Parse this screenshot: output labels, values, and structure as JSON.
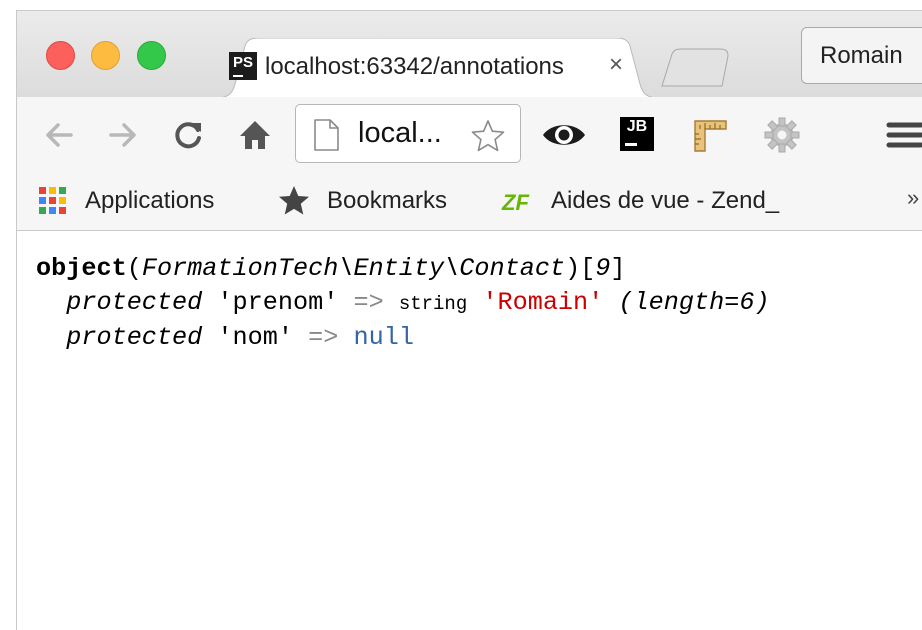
{
  "tab": {
    "favicon_text": "PS",
    "title": "localhost:63342/annotations",
    "close": "×"
  },
  "profile": {
    "name": "Romain"
  },
  "toolbar": {
    "omnibox_text": "local...",
    "jb_text": "JB"
  },
  "bookmarks_bar": {
    "items": [
      {
        "label": "Applications",
        "icon": "apps-grid-icon"
      },
      {
        "label": "Bookmarks",
        "icon": "star-icon"
      },
      {
        "label": "Aides de vue - Zend_",
        "icon": "zend-framework-icon"
      }
    ],
    "more": "»"
  },
  "var_dump": {
    "keyword": "object",
    "class_name": "FormationTech\\Entity\\Contact",
    "object_id": "9",
    "properties": [
      {
        "visibility": "protected",
        "name": "'prenom'",
        "arrow": "=>",
        "type": "string",
        "value": "'Romain'",
        "length": "(length=6)"
      },
      {
        "visibility": "protected",
        "name": "'nom'",
        "arrow": "=>",
        "value": "null"
      }
    ]
  },
  "colors": {
    "string_value": "#cc0000",
    "null_value": "#3465a4",
    "arrow": "#888a85"
  }
}
